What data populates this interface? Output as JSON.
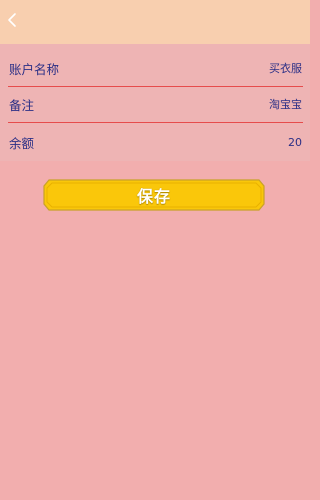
{
  "header": {
    "back_icon": "chevron-left-icon"
  },
  "form": {
    "fields": [
      {
        "label": "账户名称",
        "value": "买衣服"
      },
      {
        "label": "备注",
        "value": "淘宝宝"
      },
      {
        "label": "余额",
        "value": "20"
      }
    ]
  },
  "actions": {
    "save_label": "保存"
  },
  "colors": {
    "header_bg": "#F8CFAF",
    "page_bg": "#F2AEAE",
    "panel_bg": "#EEB4B4",
    "text": "#2B2F86",
    "divider": "#E64C4C",
    "button_fill": "#FAC70A",
    "button_border": "#C9A227"
  }
}
